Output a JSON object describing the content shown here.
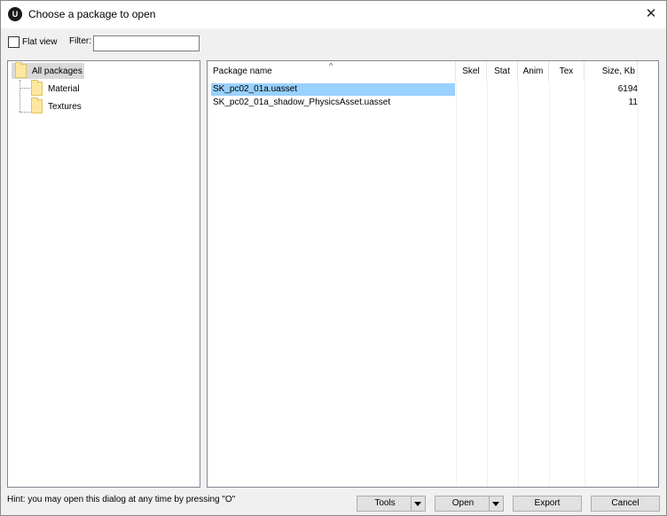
{
  "window": {
    "title": "Choose a package to open",
    "app_icon": "unreal-logo-icon",
    "close_icon": "close-icon",
    "close_glyph": "✕",
    "app_glyph": "U"
  },
  "toolbar": {
    "flat_view_label": "Flat view",
    "flat_view_checked": false,
    "filter_label": "Filter:",
    "filter_value": ""
  },
  "tree": {
    "items": [
      {
        "label": "All packages",
        "selected": true,
        "icon": "folder-icon"
      },
      {
        "label": "Material",
        "selected": false,
        "icon": "folder-icon"
      },
      {
        "label": "Textures",
        "selected": false,
        "icon": "folder-icon"
      }
    ]
  },
  "list": {
    "sort_glyph": "^",
    "columns": [
      "Package name",
      "Skel",
      "Stat",
      "Anim",
      "Tex",
      "Size, Kb"
    ],
    "rows": [
      {
        "name": "SK_pc02_01a.uasset",
        "skel": "",
        "stat": "",
        "anim": "",
        "tex": "",
        "size": "6194",
        "selected": true
      },
      {
        "name": "SK_pc02_01a_shadow_PhysicsAsset.uasset",
        "skel": "",
        "stat": "",
        "anim": "",
        "tex": "",
        "size": "11",
        "selected": false
      }
    ]
  },
  "footer": {
    "hint": "Hint: you may open this dialog at any time by pressing \"O\"",
    "tools_label": "Tools",
    "open_label": "Open",
    "export_label": "Export",
    "cancel_label": "Cancel"
  },
  "colors": {
    "selection": "#99d1ff",
    "tree_selection": "#d9d9d9",
    "folder": "#fde7a0"
  }
}
